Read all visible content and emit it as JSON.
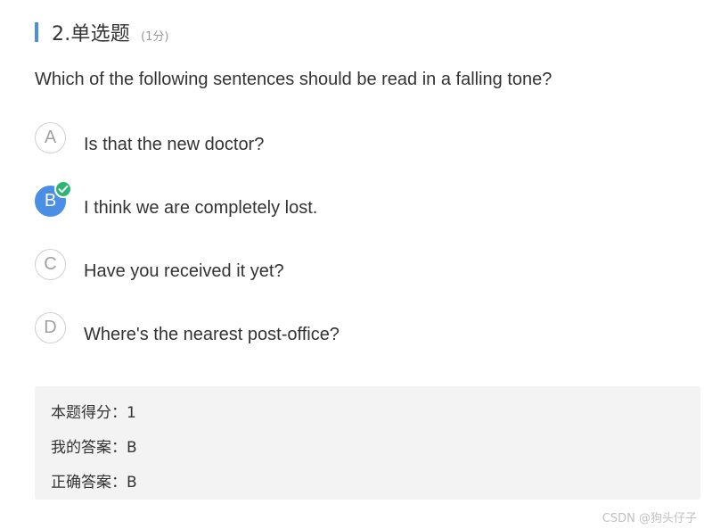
{
  "question": {
    "title": "2.单选题",
    "score": "(1分)",
    "text": "Which of the following sentences should be read in a falling tone?"
  },
  "options": [
    {
      "letter": "A",
      "text": "Is that the new doctor?",
      "selected": false
    },
    {
      "letter": "B",
      "text": "I think we are completely lost.",
      "selected": true,
      "correct_icon": "check-icon"
    },
    {
      "letter": "C",
      "text": "Have you received it yet?",
      "selected": false
    },
    {
      "letter": "D",
      "text": "Where's the nearest post-office?",
      "selected": false
    }
  ],
  "result": {
    "score_label": "本题得分：",
    "score_value": "1",
    "my_answer_label": "我的答案：",
    "my_answer_value": "B",
    "correct_answer_label": "正确答案：",
    "correct_answer_value": "B"
  },
  "watermark": "CSDN @狗头仔子",
  "colors": {
    "accent": "#4a90e2",
    "selected_option": "#4a8fe5",
    "correct_badge": "#2bb673",
    "answer_box_bg": "#f3f3f3"
  }
}
